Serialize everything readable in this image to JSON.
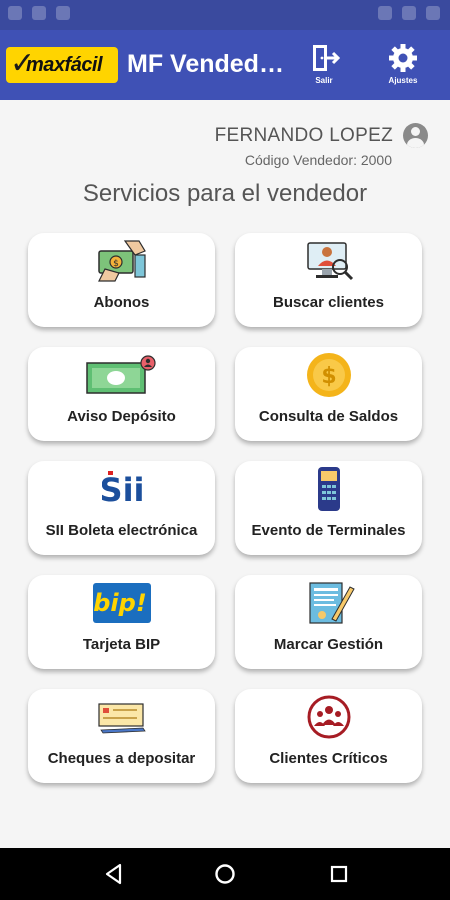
{
  "app": {
    "logo_text": "maxfácil",
    "title": "MF Vendedo...",
    "salir_label": "Salir",
    "ajustes_label": "Ajustes"
  },
  "user": {
    "name": "FERNANDO LOPEZ",
    "vendor_code": "Código Vendedor: 2000"
  },
  "section_title": "Servicios para el vendedor",
  "services": [
    {
      "label": "Abonos",
      "icon": "money-hands-icon"
    },
    {
      "label": "Buscar clientes",
      "icon": "search-client-icon"
    },
    {
      "label": "Aviso Depósito",
      "icon": "banknote-icon"
    },
    {
      "label": "Consulta de Saldos",
      "icon": "coin-icon"
    },
    {
      "label": "SII Boleta electrónica",
      "icon": "sii-logo-icon"
    },
    {
      "label": "Evento de Terminales",
      "icon": "pos-terminal-icon"
    },
    {
      "label": "Tarjeta BIP",
      "icon": "bip-card-icon"
    },
    {
      "label": "Marcar Gestión",
      "icon": "document-pen-icon"
    },
    {
      "label": "Cheques a depositar",
      "icon": "check-pen-icon"
    },
    {
      "label": "Clientes Críticos",
      "icon": "group-circle-icon"
    }
  ],
  "colors": {
    "appbar": "#3f51b5",
    "logo_bg": "#ffd400",
    "background": "#f5f5f5"
  }
}
